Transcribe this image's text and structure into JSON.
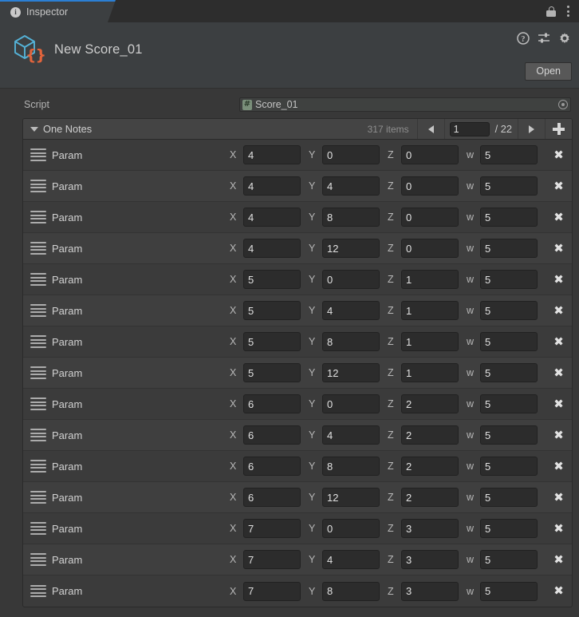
{
  "tab": {
    "label": "Inspector",
    "info_icon": "info-icon",
    "lock_icon": "lock-icon",
    "menu_icon": "kebab-menu-icon"
  },
  "header": {
    "asset_name": "New Score_01",
    "asset_icon": "scriptable-object-cube-icon",
    "braces": "{}",
    "help_icon": "help-icon",
    "preset_icon": "preset-sliders-icon",
    "settings_icon": "gear-icon",
    "open_label": "Open"
  },
  "script_field": {
    "label": "Script",
    "value": "Score_01",
    "type_icon": "csharp-script-icon",
    "type_icon_glyph": "#",
    "picker_icon": "object-picker-icon"
  },
  "list": {
    "title": "One Notes",
    "count_label": "317 items",
    "page_value": "1",
    "page_total": "/ 22",
    "prev_icon": "arrow-left-icon",
    "next_icon": "arrow-right-icon",
    "add_icon": "plus-icon",
    "foldout_icon": "foldout-expanded-icon",
    "axis_labels": [
      "X",
      "Y",
      "Z",
      "w"
    ],
    "row_label": "Param",
    "delete_glyph": "✖",
    "rows": [
      {
        "label": "Param",
        "x": "4",
        "y": "0",
        "z": "0",
        "w": "5"
      },
      {
        "label": "Param",
        "x": "4",
        "y": "4",
        "z": "0",
        "w": "5"
      },
      {
        "label": "Param",
        "x": "4",
        "y": "8",
        "z": "0",
        "w": "5"
      },
      {
        "label": "Param",
        "x": "4",
        "y": "12",
        "z": "0",
        "w": "5"
      },
      {
        "label": "Param",
        "x": "5",
        "y": "0",
        "z": "1",
        "w": "5"
      },
      {
        "label": "Param",
        "x": "5",
        "y": "4",
        "z": "1",
        "w": "5"
      },
      {
        "label": "Param",
        "x": "5",
        "y": "8",
        "z": "1",
        "w": "5"
      },
      {
        "label": "Param",
        "x": "5",
        "y": "12",
        "z": "1",
        "w": "5"
      },
      {
        "label": "Param",
        "x": "6",
        "y": "0",
        "z": "2",
        "w": "5"
      },
      {
        "label": "Param",
        "x": "6",
        "y": "4",
        "z": "2",
        "w": "5"
      },
      {
        "label": "Param",
        "x": "6",
        "y": "8",
        "z": "2",
        "w": "5"
      },
      {
        "label": "Param",
        "x": "6",
        "y": "12",
        "z": "2",
        "w": "5"
      },
      {
        "label": "Param",
        "x": "7",
        "y": "0",
        "z": "3",
        "w": "5"
      },
      {
        "label": "Param",
        "x": "7",
        "y": "4",
        "z": "3",
        "w": "5"
      },
      {
        "label": "Param",
        "x": "7",
        "y": "8",
        "z": "3",
        "w": "5"
      }
    ]
  },
  "colors": {
    "accent": "#2b7fd4",
    "window_bg": "#383838",
    "panel_bg": "#3c3f41",
    "tabbar_bg": "#2d2d2d",
    "field_bg": "#2c2c2c",
    "icon_blue": "#54b1d6",
    "icon_orange": "#e2643c"
  }
}
